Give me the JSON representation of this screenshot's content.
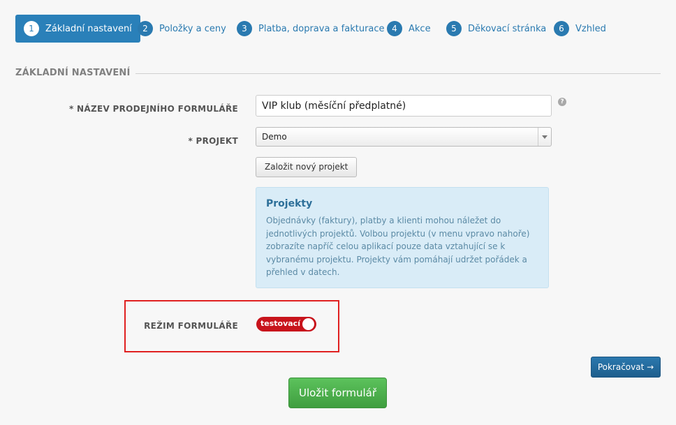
{
  "steps": [
    {
      "num": "1",
      "label": "Základní nastavení"
    },
    {
      "num": "2",
      "label": "Položky a ceny"
    },
    {
      "num": "3",
      "label": "Platba, doprava a fakturace"
    },
    {
      "num": "4",
      "label": "Akce"
    },
    {
      "num": "5",
      "label": "Děkovací stránka"
    },
    {
      "num": "6",
      "label": "Vzhled"
    }
  ],
  "section": {
    "title": "ZÁKLADNÍ NASTAVENÍ"
  },
  "form": {
    "name_label": "* NÁZEV PRODEJNÍHO FORMULÁŘE",
    "name_value": "VIP klub (měsíční předplatné)",
    "help_icon": "?",
    "project_label": "* PROJEKT",
    "project_value": "Demo",
    "new_project_button": "Založit nový projekt",
    "mode_label": "REŽIM FORMULÁŘE",
    "mode_value": "testovací"
  },
  "info": {
    "title": "Projekty",
    "text": "Objednávky (faktury), platby a klienti mohou náležet do jednotlivých projektů. Volbou projektu (v menu vpravo nahoře) zobrazíte napříč celou aplikací pouze data vztahující se k vybranému projektu. Projekty vám pomáhají udržet pořádek a přehled v datech."
  },
  "actions": {
    "continue": "Pokračovat →",
    "save": "Uložit formulář"
  },
  "colors": {
    "primary": "#2a80b9",
    "toggle": "#c8141c",
    "save": "#4caf50",
    "highlight": "#e02020"
  }
}
